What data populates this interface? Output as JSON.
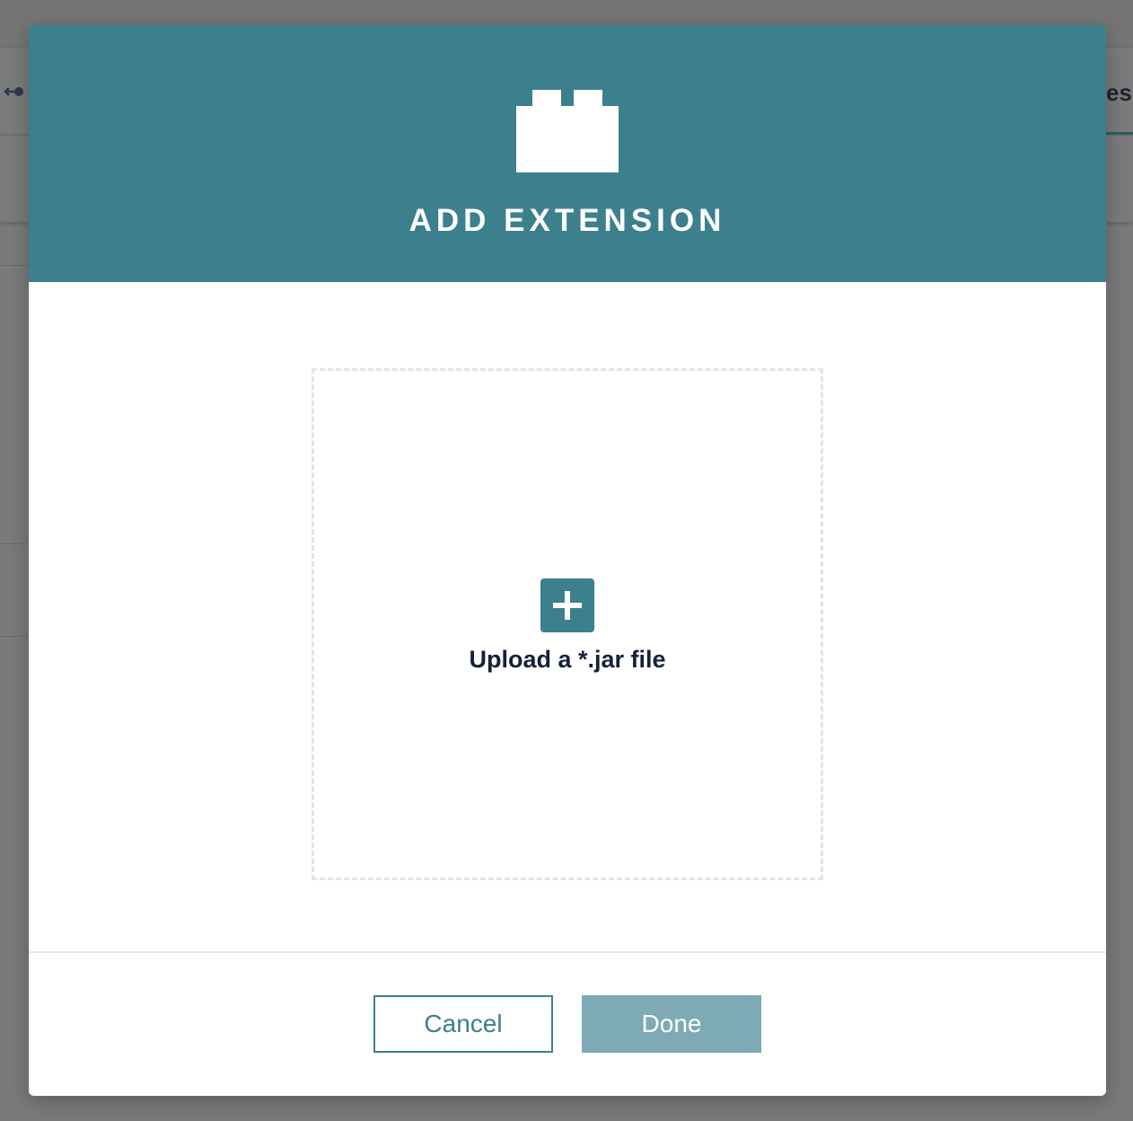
{
  "background": {
    "tab_partial_text": "es"
  },
  "modal": {
    "header_icon": "puzzle-block-icon",
    "title": "ADD EXTENSION",
    "dropzone": {
      "icon": "plus-icon",
      "label": "Upload a *.jar file"
    },
    "buttons": {
      "cancel_label": "Cancel",
      "done_label": "Done"
    }
  },
  "colors": {
    "accent": "#3c7f8d",
    "done_disabled": "#7eaab5",
    "text_dark": "#14213a",
    "overlay": "#747474"
  }
}
